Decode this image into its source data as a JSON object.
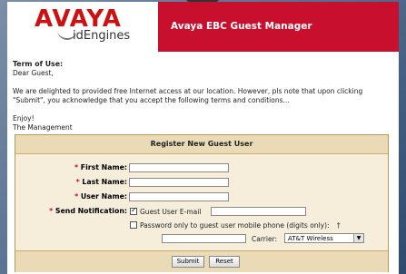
{
  "header": {
    "logo_main": "AVAYA",
    "logo_sub": "idEngines",
    "title": "Avaya EBC Guest Manager"
  },
  "terms": {
    "heading": "Term of Use:",
    "greeting": "Dear Guest,",
    "body": "We are delighted to provided free Internet access at our location. However, pls note that upon clicking \"Submit\", you acknowledge that you accept the following terms and conditions...",
    "closing1": "Enjoy!",
    "closing2": "The Management"
  },
  "form": {
    "title": "Register New Guest User",
    "required_mark": "*",
    "first_name_label": "First Name:",
    "last_name_label": "Last Name:",
    "user_name_label": "User Name:",
    "send_notification_label": "Send Notification:",
    "email_option_label": "Guest User E-mail",
    "email_option_checked": true,
    "sms_option_label": "Password only to guest user mobile phone (digits only):",
    "sms_option_mark": "†",
    "sms_option_checked": false,
    "carrier_label": "Carrier:",
    "carrier_selected": "AT&T Wireless",
    "first_name_value": "",
    "last_name_value": "",
    "user_name_value": "",
    "email_value": "",
    "phone_value": ""
  },
  "buttons": {
    "submit": "Submit",
    "reset": "Reset"
  },
  "icons": {
    "dropdown": "chevron-down-icon",
    "checkbox_checked": "checkmark-icon"
  },
  "colors": {
    "brand_red": "#c8102e",
    "form_bg": "#f6eedb",
    "form_header": "#eadbb6"
  }
}
